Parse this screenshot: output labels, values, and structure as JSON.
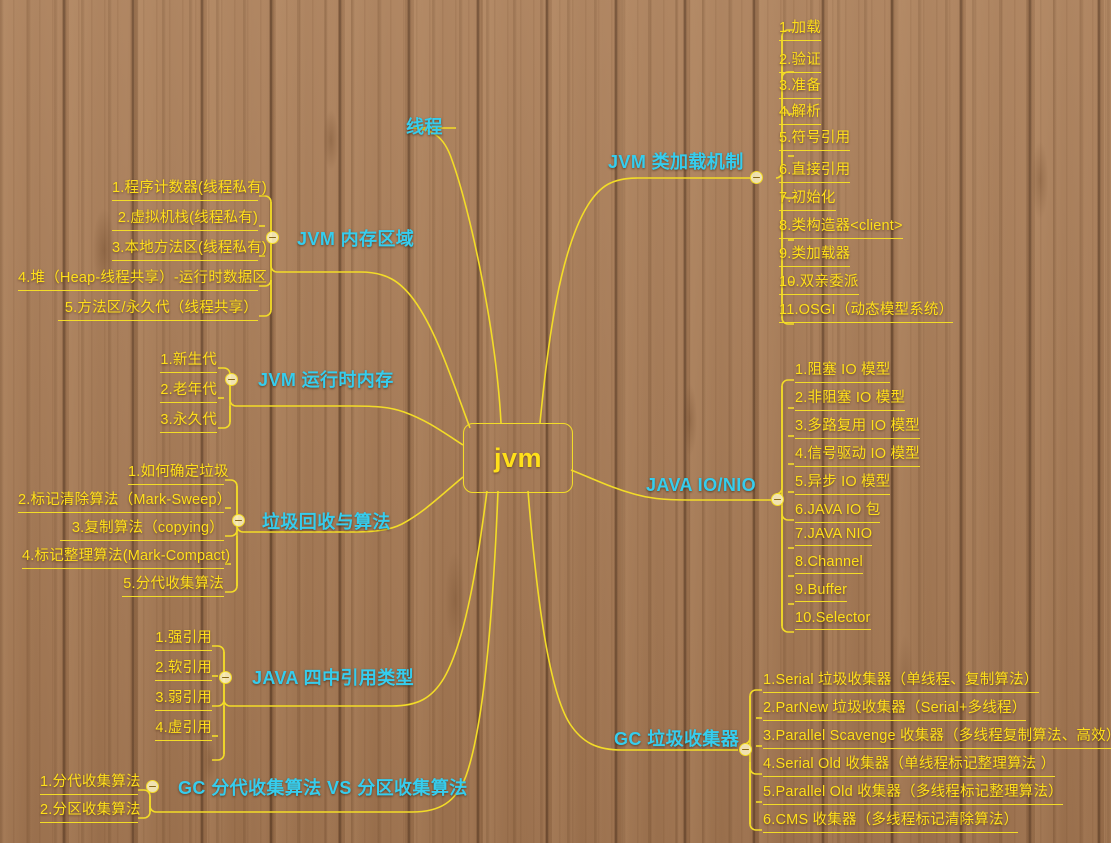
{
  "theme": {
    "background": "#a87c57",
    "line_color": "#f3dc27",
    "leaf_text_color": "#ffe01a",
    "branch_text_color": "#35cdee",
    "root_text_color": "#ffe01a"
  },
  "root": {
    "label": "jvm"
  },
  "branches": [
    {
      "id": "thread",
      "label": "线程",
      "side": "top",
      "collapsible": false,
      "children": []
    },
    {
      "id": "class-loading",
      "label": "JVM 类加载机制",
      "side": "right",
      "collapsible": true,
      "children": [
        "1.加载",
        "2.验证",
        "3.准备",
        "4.解析",
        "5.符号引用",
        "6.直接引用",
        "7.初始化",
        "8.类构造器<client>",
        "9.类加载器",
        "10.双亲委派",
        "11.OSGI（动态模型系统）"
      ]
    },
    {
      "id": "memory-area",
      "label": "JVM 内存区域",
      "side": "left",
      "collapsible": true,
      "children": [
        "1.程序计数器(线程私有)",
        "2.虚拟机栈(线程私有)",
        "3.本地方法区(线程私有)",
        "4.堆（Heap-线程共享）-运行时数据区",
        "5.方法区/永久代（线程共享）"
      ]
    },
    {
      "id": "runtime-memory",
      "label": "JVM 运行时内存",
      "side": "left",
      "collapsible": true,
      "children": [
        "1.新生代",
        "2.老年代",
        "3.永久代"
      ]
    },
    {
      "id": "gc-algorithms",
      "label": "垃圾回收与算法",
      "side": "left",
      "collapsible": true,
      "children": [
        "1.如何确定垃圾",
        "2.标记清除算法（Mark-Sweep）",
        "3.复制算法（copying）",
        "4.标记整理算法(Mark-Compact)",
        "5.分代收集算法"
      ]
    },
    {
      "id": "reference-types",
      "label": "JAVA 四中引用类型",
      "side": "left",
      "collapsible": true,
      "children": [
        "1.强引用",
        "2.软引用",
        "3.弱引用",
        "4.虚引用"
      ]
    },
    {
      "id": "gc-generational-vs-partition",
      "label": "GC 分代收集算法 VS 分区收集算法",
      "side": "left",
      "collapsible": true,
      "children": [
        "1.分代收集算法",
        "2.分区收集算法"
      ]
    },
    {
      "id": "java-io-nio",
      "label": "JAVA IO/NIO",
      "side": "right",
      "collapsible": true,
      "children": [
        "1.阻塞 IO 模型",
        "2.非阻塞 IO 模型",
        "3.多路复用 IO 模型",
        "4.信号驱动 IO 模型",
        "5.异步 IO 模型",
        "6.JAVA IO 包",
        "7.JAVA NIO",
        "8.Channel",
        "9.Buffer",
        "10.Selector"
      ]
    },
    {
      "id": "gc-collectors",
      "label": "GC 垃圾收集器",
      "side": "right",
      "collapsible": true,
      "children": [
        "1.Serial 垃圾收集器（单线程、复制算法）",
        "2.ParNew 垃圾收集器（Serial+多线程）",
        "3.Parallel Scavenge 收集器（多线程复制算法、高效）",
        "4.Serial Old 收集器（单线程标记整理算法 ）",
        "5.Parallel Old 收集器（多线程标记整理算法）",
        "6.CMS 收集器（多线程标记清除算法）"
      ]
    }
  ]
}
